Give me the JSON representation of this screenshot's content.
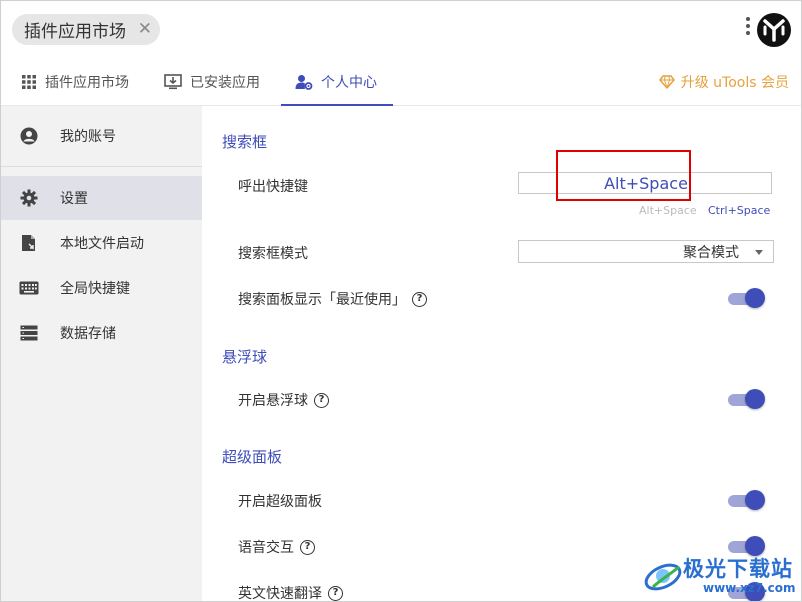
{
  "header": {
    "search_label": "插件应用市场",
    "close_glyph": "✕"
  },
  "tabs": [
    {
      "label": "插件应用市场",
      "icon": "grid-icon"
    },
    {
      "label": "已安装应用",
      "icon": "installed-icon"
    },
    {
      "label": "个人中心",
      "icon": "user-settings-icon",
      "active": true
    }
  ],
  "upgrade_label": "升级 uTools 会员",
  "sidebar": {
    "items": [
      {
        "label": "我的账号",
        "icon": "account-icon"
      },
      {
        "label": "设置",
        "icon": "gear-icon",
        "active": true
      },
      {
        "label": "本地文件启动",
        "icon": "local-file-icon"
      },
      {
        "label": "全局快捷键",
        "icon": "keyboard-icon"
      },
      {
        "label": "数据存储",
        "icon": "storage-icon"
      }
    ]
  },
  "main": {
    "sections": {
      "search": {
        "title": "搜索框",
        "hotkey_label": "呼出快捷键",
        "hotkey_value": "Alt+Space",
        "preset_alt": "Alt+Space",
        "preset_ctrl": "Ctrl+Space",
        "mode_label": "搜索框模式",
        "mode_value": "聚合模式",
        "recent_label": "搜索面板显示「最近使用」",
        "recent_on": true
      },
      "float": {
        "title": "悬浮球",
        "enable_label": "开启悬浮球",
        "enable_on": true
      },
      "super": {
        "title": "超级面板",
        "enable_label": "开启超级面板",
        "enable_on": true,
        "voice_label": "语音交互",
        "voice_on": true,
        "translate_label": "英文快速翻译",
        "translate_on": true
      }
    }
  },
  "watermark": {
    "text": "极光下载站",
    "url": "www.xz7.com"
  },
  "colors": {
    "accent": "#3f4db8",
    "upgrade": "#e6a23c",
    "highlight_box": "#e00000"
  }
}
